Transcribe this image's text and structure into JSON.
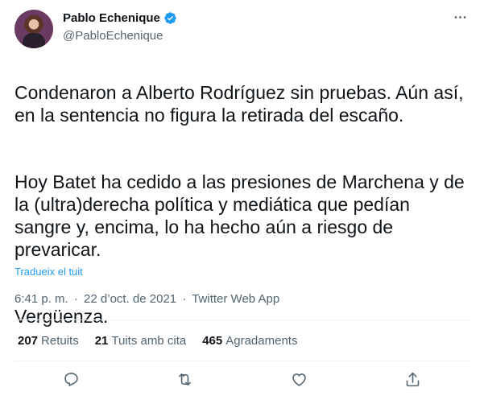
{
  "author": {
    "display_name": "Pablo Echenique",
    "handle": "@PabloEchenique"
  },
  "tweet": {
    "paragraphs": [
      "Condenaron a Alberto Rodríguez sin pruebas. Aún así,\nen la sentencia no figura la retirada del escaño.",
      "Hoy Batet ha cedido a las presiones de Marchena y de\nla (ultra)derecha política y mediática que pedían\nsangre y, encima, lo ha hecho aún a riesgo de\nprevaricar.",
      "Vergüenza."
    ],
    "translate_label": "Tradueix el tuit"
  },
  "meta": {
    "time": "6:41 p. m.",
    "date": "22 d’oct. de 2021",
    "source": "Twitter Web App",
    "separator": "·"
  },
  "stats": [
    {
      "count": "207",
      "label": "Retuits"
    },
    {
      "count": "21",
      "label": "Tuits amb cita"
    },
    {
      "count": "465",
      "label": "Agradaments"
    }
  ],
  "icons": {
    "verified": "verified-badge-icon",
    "more": "more-horizontal-icon",
    "reply": "reply-icon",
    "retweet": "retweet-icon",
    "like": "heart-icon",
    "share": "share-icon"
  },
  "colors": {
    "accent": "#1d9bf0",
    "secondary_text": "#536471",
    "primary_text": "#0f1419"
  }
}
